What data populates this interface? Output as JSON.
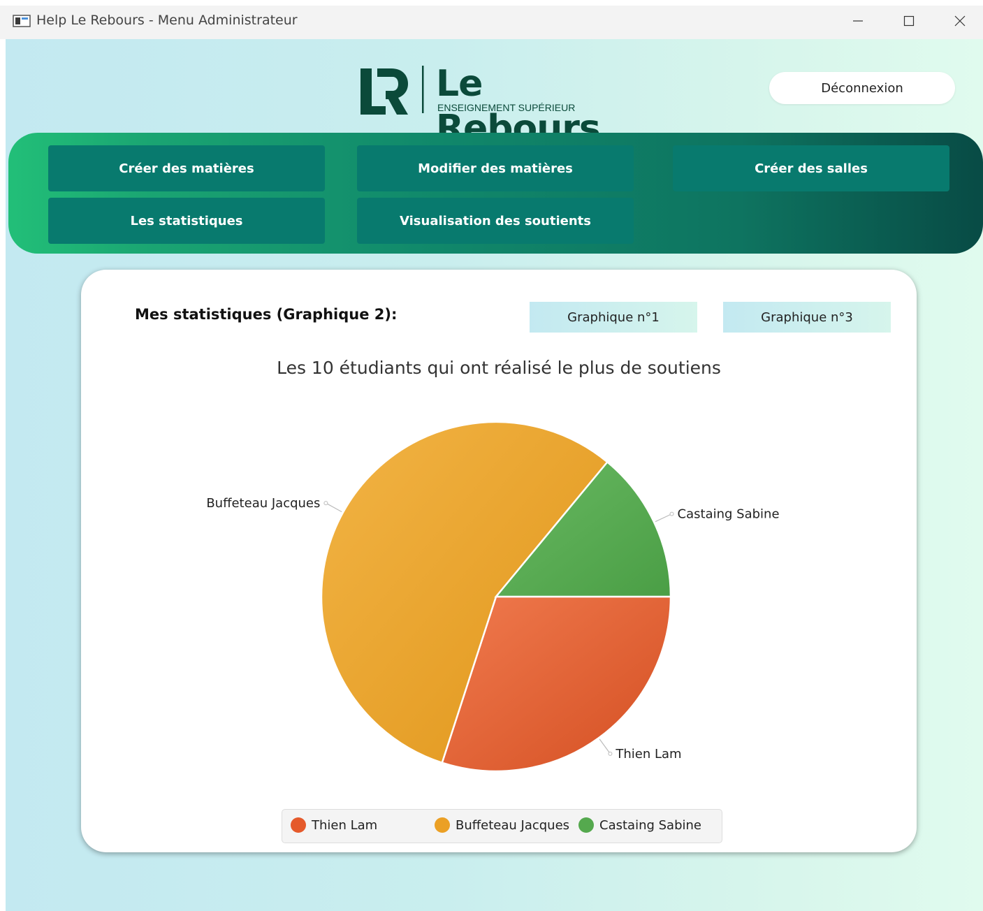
{
  "window": {
    "title": "Help Le Rebours - Menu Administrateur"
  },
  "logo": {
    "name": "Le Rebours",
    "subtitle": "ENSEIGNEMENT SUPÉRIEUR",
    "primary_color": "#0b4a3a"
  },
  "header": {
    "logout_label": "Déconnexion"
  },
  "nav": {
    "items": [
      {
        "label": "Créer des matières"
      },
      {
        "label": "Modifier des matières"
      },
      {
        "label": "Créer des salles"
      },
      {
        "label": "Les statistiques"
      },
      {
        "label": "Visualisation des soutients"
      }
    ]
  },
  "stats": {
    "heading": "Mes statistiques (Graphique 2):",
    "buttons": [
      {
        "label": "Graphique n°1"
      },
      {
        "label": "Graphique n°3"
      }
    ]
  },
  "chart_data": {
    "type": "pie",
    "title": "Les 10 étudiants qui ont réalisé le plus de soutiens",
    "slices": [
      {
        "name": "Thien Lam",
        "value": 30,
        "color": "#e55a2b"
      },
      {
        "name": "Buffeteau Jacques",
        "value": 56,
        "color": "#eba025"
      },
      {
        "name": "Castaing Sabine",
        "value": 14,
        "color": "#55a94e"
      }
    ],
    "legend_position": "bottom"
  },
  "colors": {
    "nav_button": "#087a6e",
    "accent_green": "#22bf78"
  }
}
